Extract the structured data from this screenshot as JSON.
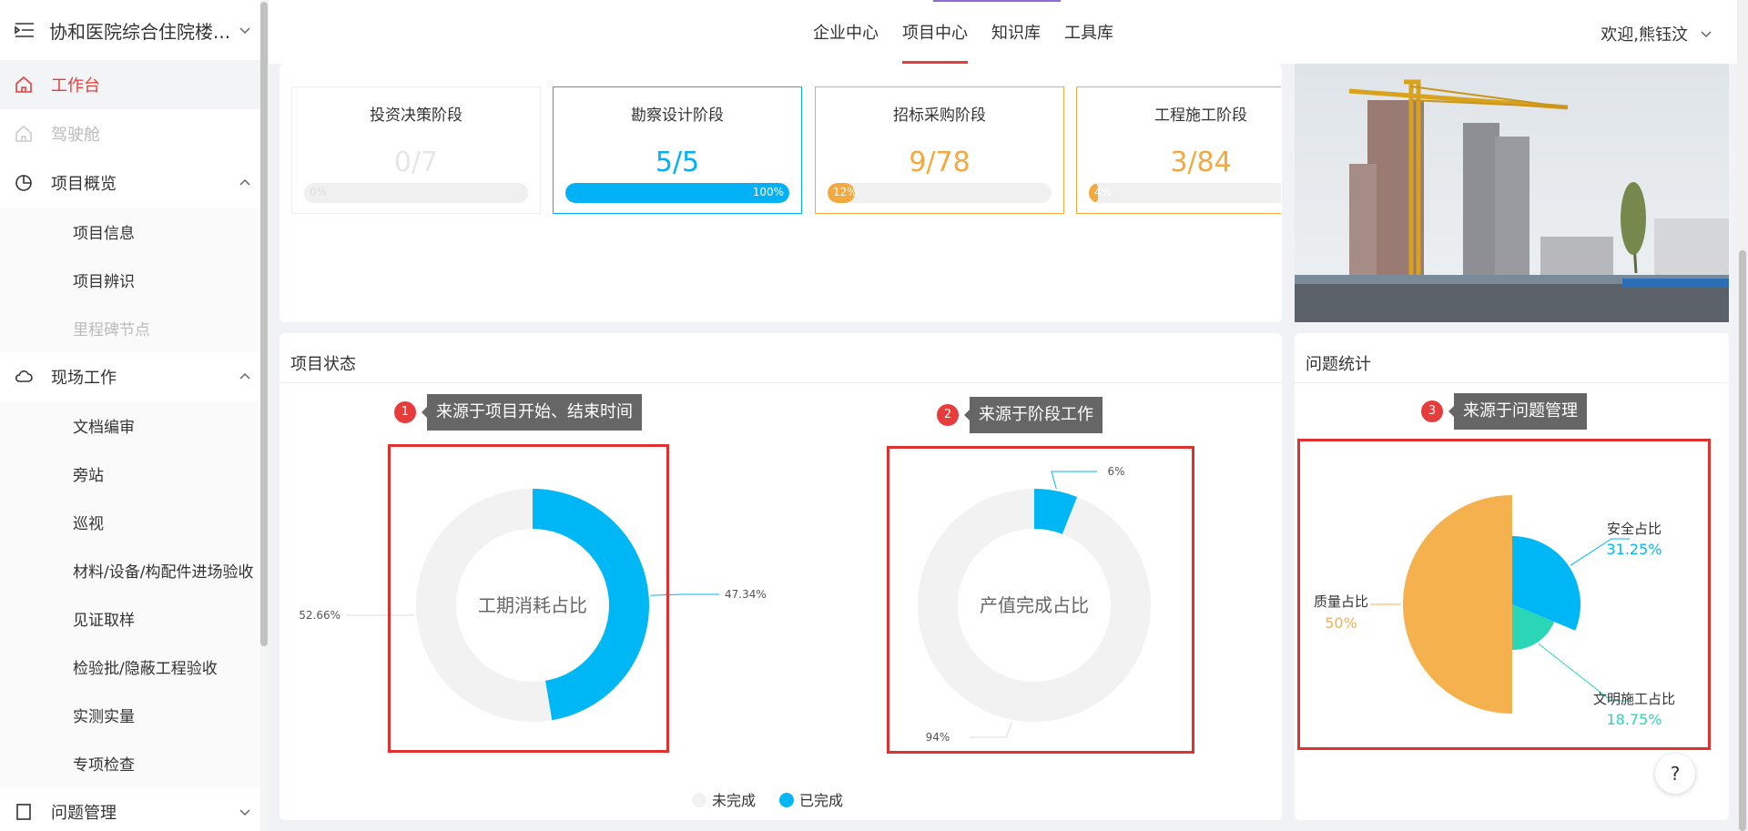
{
  "sidebar": {
    "project_name": "协和医院综合住院楼...",
    "items": [
      {
        "label": "工作台",
        "icon": "home-icon",
        "state": "active"
      },
      {
        "label": "驾驶舱",
        "icon": "home-icon",
        "state": "disabled"
      },
      {
        "label": "项目概览",
        "icon": "pie-icon",
        "state": "expanded"
      },
      {
        "label": "现场工作",
        "icon": "cloud-icon",
        "state": "expanded"
      },
      {
        "label": "问题管理",
        "icon": "document-icon",
        "state": "collapsed"
      }
    ],
    "overview_sub": [
      {
        "label": "项目信息",
        "disabled": false
      },
      {
        "label": "项目辨识",
        "disabled": false
      },
      {
        "label": "里程碑节点",
        "disabled": true
      }
    ],
    "field_sub": [
      {
        "label": "文档编审"
      },
      {
        "label": "旁站"
      },
      {
        "label": "巡视"
      },
      {
        "label": "材料/设备/构配件进场验收"
      },
      {
        "label": "见证取样"
      },
      {
        "label": "检验批/隐蔽工程验收"
      },
      {
        "label": "实测实量"
      },
      {
        "label": "专项检查"
      }
    ]
  },
  "topbar": {
    "tabs": [
      "企业中心",
      "项目中心",
      "知识库",
      "工具库"
    ],
    "active_tab": "项目中心",
    "user_greeting": "欢迎,熊钰汶"
  },
  "stages": [
    {
      "title": "投资决策阶段",
      "value": "0/7",
      "percent": 0,
      "pct_label": "0%",
      "color": "#dddddd",
      "val_color": "#e6e6e6",
      "border": "#eeeeee"
    },
    {
      "title": "勘察设计阶段",
      "value": "5/5",
      "percent": 100,
      "pct_label": "100%",
      "color": "#00b2f5",
      "val_color": "#00b2f5",
      "border": "#00b2f5"
    },
    {
      "title": "招标采购阶段",
      "value": "9/78",
      "percent": 12,
      "pct_label": "12%",
      "color": "#f4a93e",
      "val_color": "#f4a93e",
      "border": "#f4a93e"
    },
    {
      "title": "工程施工阶段",
      "value": "3/84",
      "percent": 4,
      "pct_label": "4%",
      "color": "#f4a93e",
      "val_color": "#f4a93e",
      "border": "#f4a93e"
    }
  ],
  "status_card": {
    "title": "项目状态",
    "tip1": {
      "num": "1",
      "text": "来源于项目开始、结束时间"
    },
    "tip2": {
      "num": "2",
      "text": "来源于阶段工作"
    },
    "legend": [
      {
        "label": "未完成",
        "color": "#f2f2f2"
      },
      {
        "label": "已完成",
        "color": "#00b7f5"
      }
    ]
  },
  "issue_card": {
    "title": "问题统计",
    "tip3": {
      "num": "3",
      "text": "来源于问题管理"
    }
  },
  "chart_data": [
    {
      "type": "pie",
      "title": "工期消耗占比",
      "labels": [
        "已完成",
        "未完成"
      ],
      "values": [
        47.34,
        52.66
      ],
      "value_labels": [
        "47.34%",
        "52.66%"
      ],
      "colors": [
        "#00b7f5",
        "#f2f2f2"
      ]
    },
    {
      "type": "pie",
      "title": "产值完成占比",
      "labels": [
        "已完成",
        "未完成"
      ],
      "values": [
        6,
        94
      ],
      "value_labels": [
        "6%",
        "94%"
      ],
      "colors": [
        "#00b7f5",
        "#f2f2f2"
      ]
    },
    {
      "type": "pie",
      "labels": [
        "安全占比",
        "文明施工占比",
        "质量占比"
      ],
      "values": [
        31.25,
        18.75,
        50
      ],
      "value_labels": [
        "31.25%",
        "18.75%",
        "50%"
      ],
      "colors": [
        "#00b7f5",
        "#2bd6b6",
        "#f5b14e"
      ],
      "radii": [
        75,
        50,
        120
      ]
    }
  ],
  "help_label": "?"
}
